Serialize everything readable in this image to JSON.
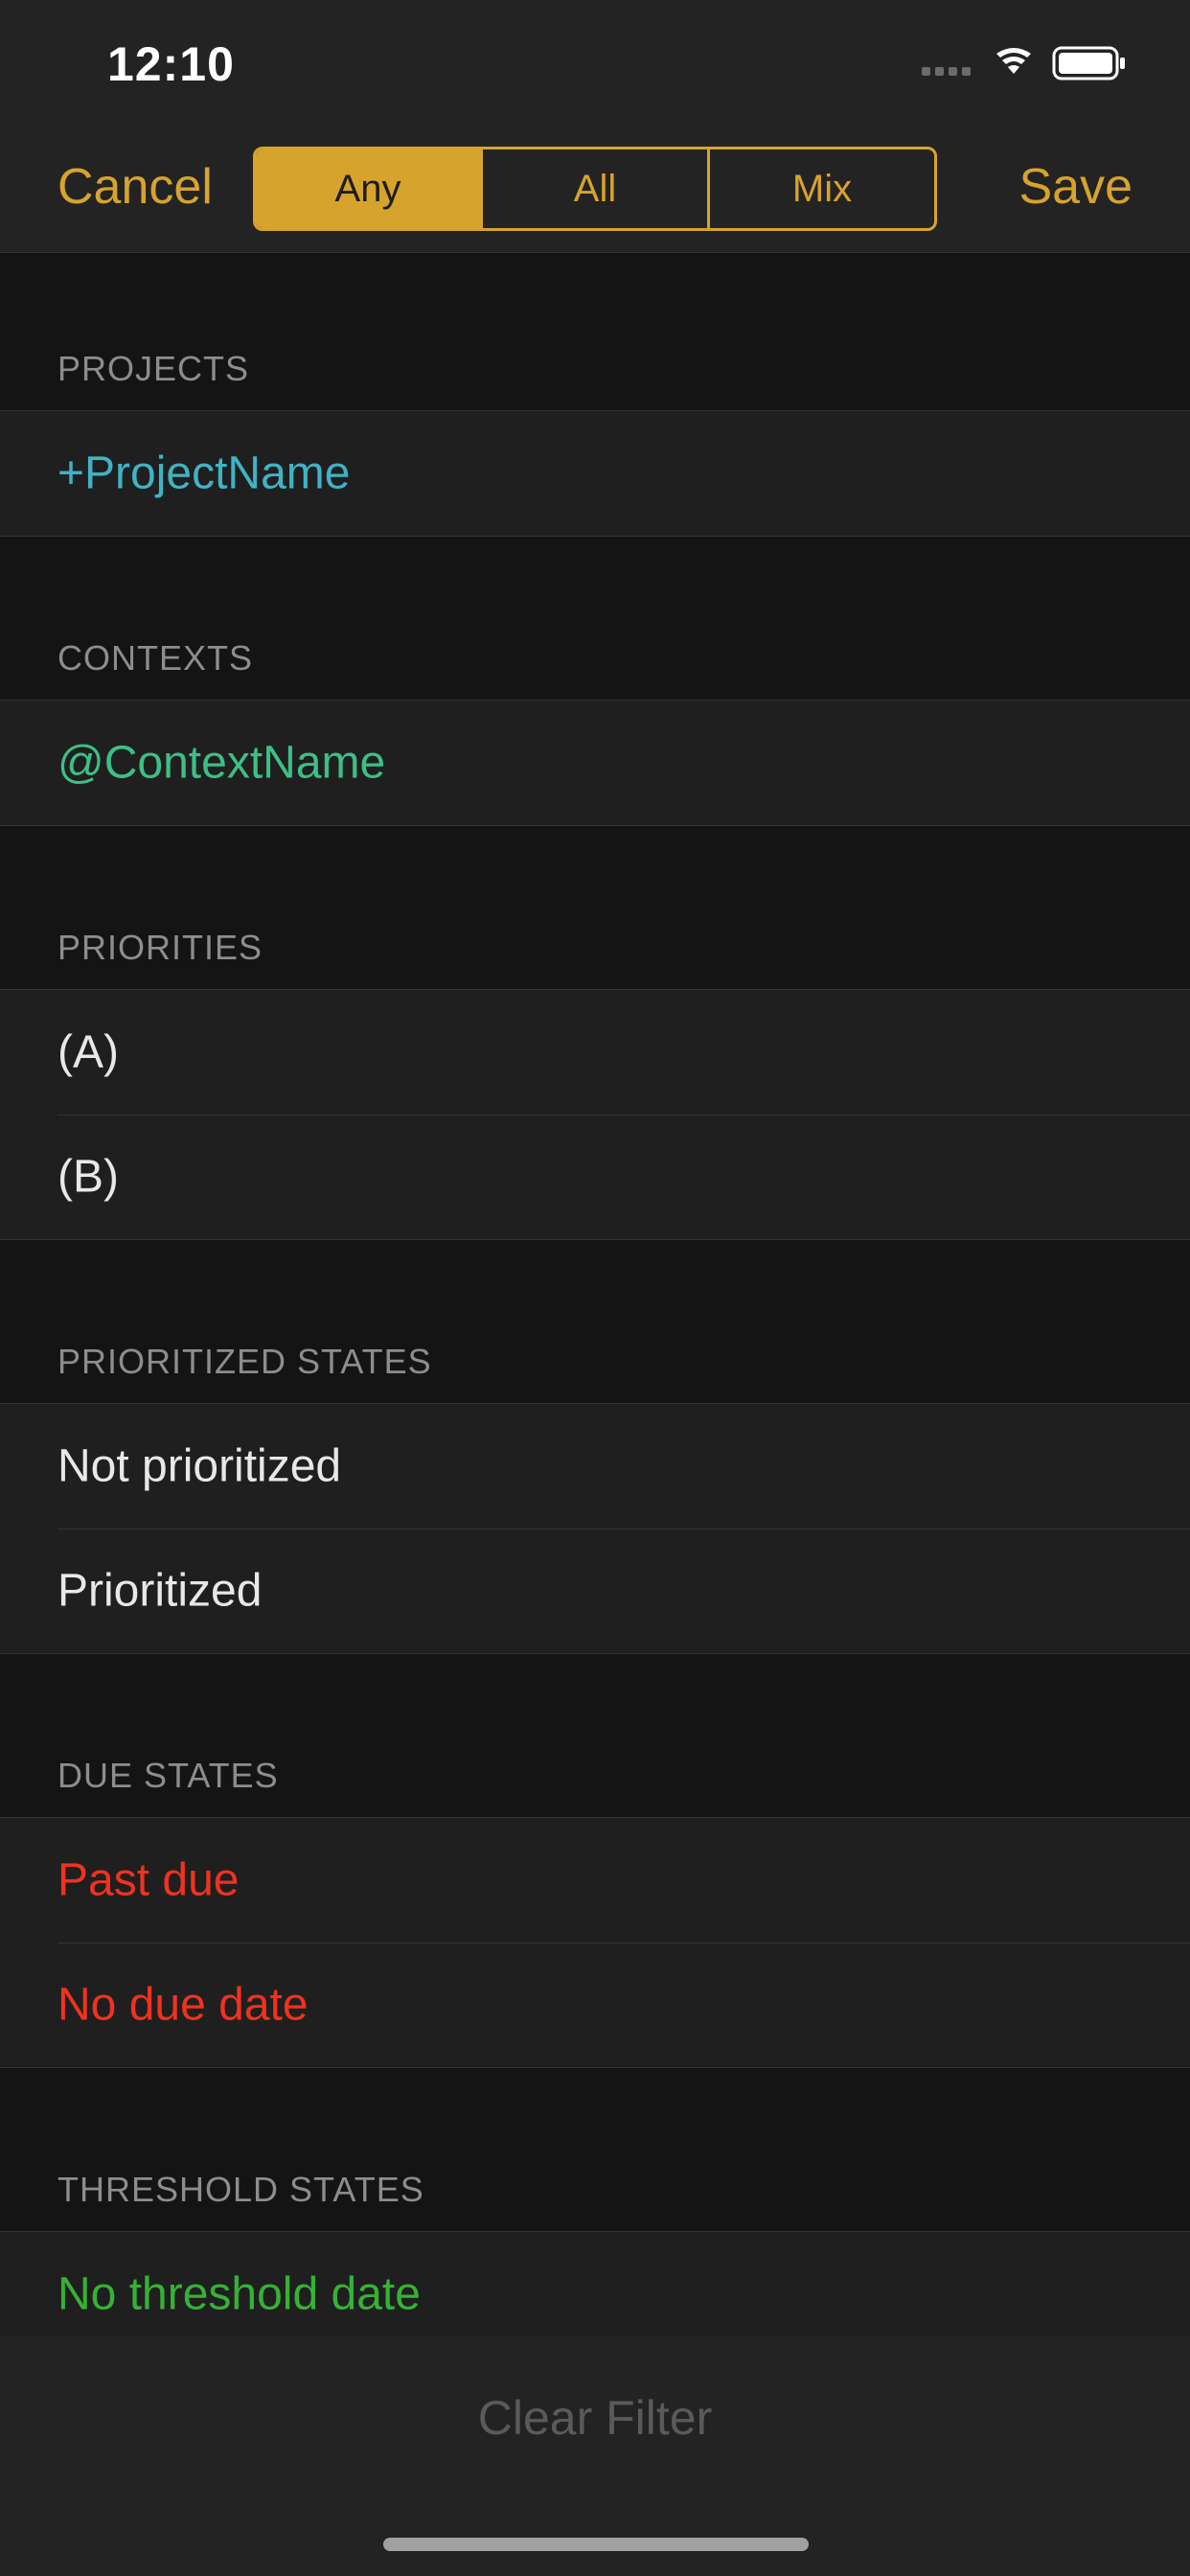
{
  "status_bar": {
    "time": "12:10"
  },
  "nav": {
    "cancel_label": "Cancel",
    "save_label": "Save",
    "segments": [
      "Any",
      "All",
      "Mix"
    ],
    "selected_segment": "Any"
  },
  "sections": {
    "projects": {
      "header": "PROJECTS",
      "items": [
        "+ProjectName"
      ]
    },
    "contexts": {
      "header": "CONTEXTS",
      "items": [
        "@ContextName"
      ]
    },
    "priorities": {
      "header": "PRIORITIES",
      "items": [
        "(A)",
        "(B)"
      ]
    },
    "prioritized_states": {
      "header": "PRIORITIZED STATES",
      "items": [
        "Not prioritized",
        "Prioritized"
      ]
    },
    "due_states": {
      "header": "DUE STATES",
      "items": [
        "Past due",
        "No due date"
      ]
    },
    "threshold_states": {
      "header": "THRESHOLD STATES",
      "items": [
        "No threshold date"
      ]
    }
  },
  "footer": {
    "clear_label": "Clear Filter"
  },
  "colors": {
    "accent": "#d6a32d",
    "project": "#3fb3c4",
    "context": "#3dbf85",
    "due": "#f0321e",
    "threshold": "#35b235",
    "default_text": "#e8e8e8"
  }
}
